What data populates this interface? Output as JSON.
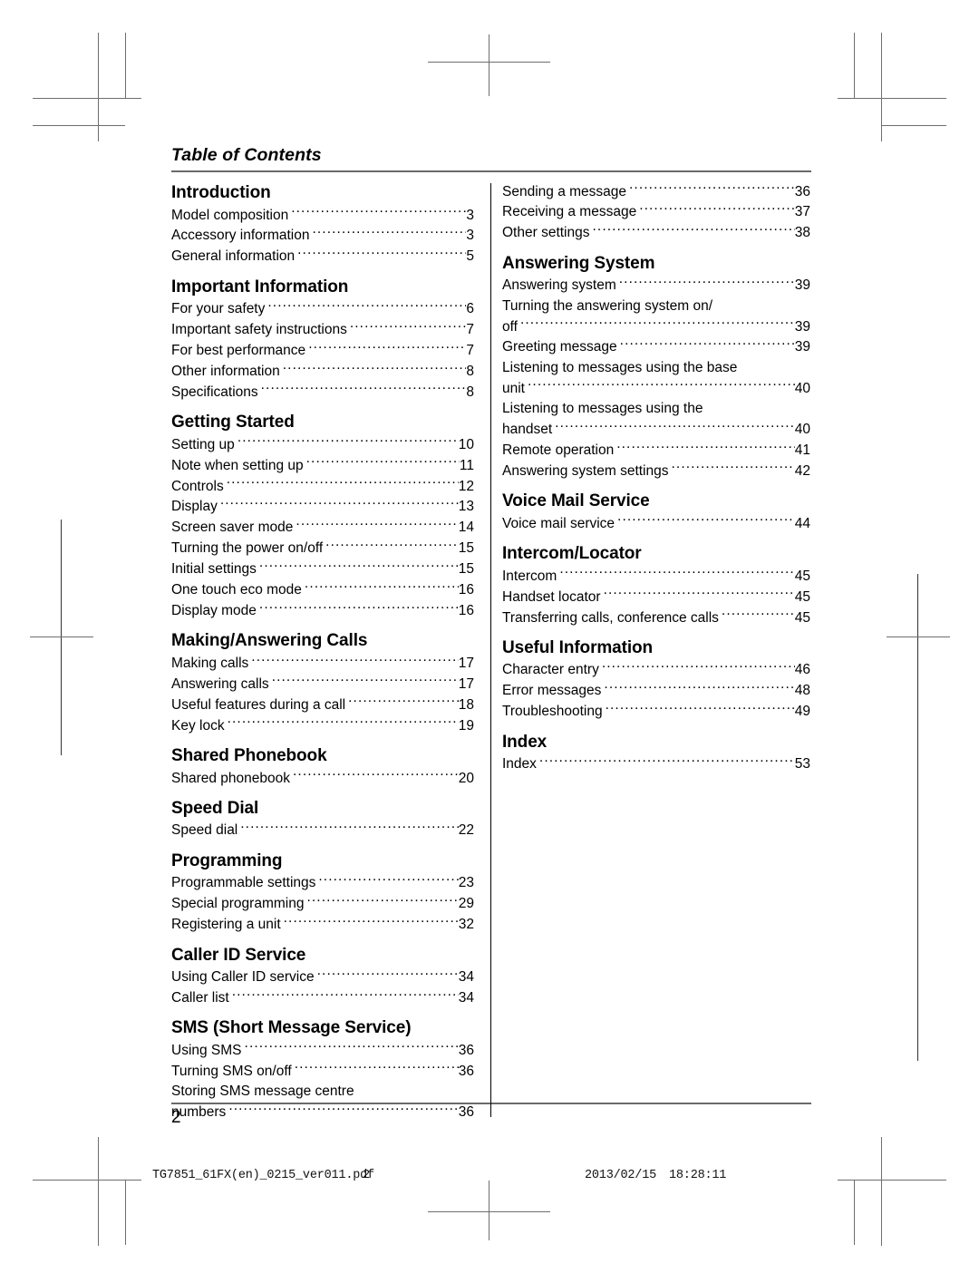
{
  "header": {
    "title": "Table of Contents"
  },
  "page_number": "2",
  "slug": {
    "filename": "TG7851_61FX(en)_0215_ver011.pdf",
    "sheet": "2",
    "date": "2013/02/15",
    "time": "18:28:11"
  },
  "columns": {
    "left": [
      {
        "chapter": "Introduction",
        "entries": [
          {
            "title": "Model composition",
            "page": "3"
          },
          {
            "title": "Accessory information",
            "page": "3"
          },
          {
            "title": "General information",
            "page": "5"
          }
        ]
      },
      {
        "chapter": "Important Information",
        "entries": [
          {
            "title": "For your safety",
            "page": "6"
          },
          {
            "title": "Important safety instructions",
            "page": "7"
          },
          {
            "title": "For best performance",
            "page": "7"
          },
          {
            "title": "Other information",
            "page": "8"
          },
          {
            "title": "Specifications",
            "page": "8"
          }
        ]
      },
      {
        "chapter": "Getting Started",
        "entries": [
          {
            "title": "Setting up",
            "page": "10"
          },
          {
            "title": "Note when setting up",
            "page": "11"
          },
          {
            "title": "Controls",
            "page": "12"
          },
          {
            "title": "Display",
            "page": "13"
          },
          {
            "title": "Screen saver mode",
            "page": "14"
          },
          {
            "title": "Turning the power on/off",
            "page": "15"
          },
          {
            "title": "Initial settings",
            "page": "15"
          },
          {
            "title": "One touch eco mode",
            "page": "16"
          },
          {
            "title": "Display mode",
            "page": "16"
          }
        ]
      },
      {
        "chapter": "Making/Answering Calls",
        "entries": [
          {
            "title": "Making calls",
            "page": "17"
          },
          {
            "title": "Answering calls",
            "page": "17"
          },
          {
            "title": "Useful features during a call",
            "page": "18"
          },
          {
            "title": "Key lock",
            "page": "19"
          }
        ]
      },
      {
        "chapter": "Shared Phonebook",
        "entries": [
          {
            "title": "Shared phonebook",
            "page": "20"
          }
        ]
      },
      {
        "chapter": "Speed Dial",
        "entries": [
          {
            "title": "Speed dial",
            "page": "22"
          }
        ]
      },
      {
        "chapter": "Programming",
        "entries": [
          {
            "title": "Programmable settings",
            "page": "23"
          },
          {
            "title": "Special programming",
            "page": "29"
          },
          {
            "title": "Registering a unit",
            "page": "32"
          }
        ]
      },
      {
        "chapter": "Caller ID Service",
        "entries": [
          {
            "title": "Using Caller ID service",
            "page": "34"
          },
          {
            "title": "Caller list",
            "page": "34"
          }
        ]
      },
      {
        "chapter": "SMS (Short Message Service)",
        "entries": [
          {
            "title": "Using SMS",
            "page": "36"
          },
          {
            "title": "Turning SMS on/off",
            "page": "36"
          },
          {
            "title": "Storing SMS message centre",
            "page": "",
            "wrap_first": true
          },
          {
            "title": "numbers",
            "page": "36"
          }
        ]
      }
    ],
    "right": [
      {
        "chapter": "",
        "entries": [
          {
            "title": "Sending a message",
            "page": "36"
          },
          {
            "title": "Receiving a message",
            "page": "37"
          },
          {
            "title": "Other settings",
            "page": "38"
          }
        ]
      },
      {
        "chapter": "Answering System",
        "entries": [
          {
            "title": "Answering system",
            "page": "39"
          },
          {
            "title": "Turning the answering system on/",
            "page": "",
            "wrap_first": true
          },
          {
            "title": "off",
            "page": "39"
          },
          {
            "title": "Greeting message",
            "page": "39"
          },
          {
            "title": "Listening to messages using the base",
            "page": "",
            "wrap_first": true
          },
          {
            "title": "unit",
            "page": "40"
          },
          {
            "title": "Listening to messages using the",
            "page": "",
            "wrap_first": true
          },
          {
            "title": "handset",
            "page": "40"
          },
          {
            "title": "Remote operation",
            "page": "41"
          },
          {
            "title": "Answering system settings",
            "page": "42"
          }
        ]
      },
      {
        "chapter": "Voice Mail Service",
        "entries": [
          {
            "title": "Voice mail service",
            "page": "44"
          }
        ]
      },
      {
        "chapter": "Intercom/Locator",
        "entries": [
          {
            "title": "Intercom",
            "page": "45"
          },
          {
            "title": "Handset locator",
            "page": "45"
          },
          {
            "title": "Transferring calls, conference calls",
            "page": "45"
          }
        ]
      },
      {
        "chapter": "Useful Information",
        "entries": [
          {
            "title": "Character entry",
            "page": "46"
          },
          {
            "title": "Error messages",
            "page": "48"
          },
          {
            "title": "Troubleshooting",
            "page": "49"
          }
        ]
      },
      {
        "chapter": "Index",
        "entries": [
          {
            "title": "Index",
            "page": "53"
          }
        ]
      }
    ]
  }
}
